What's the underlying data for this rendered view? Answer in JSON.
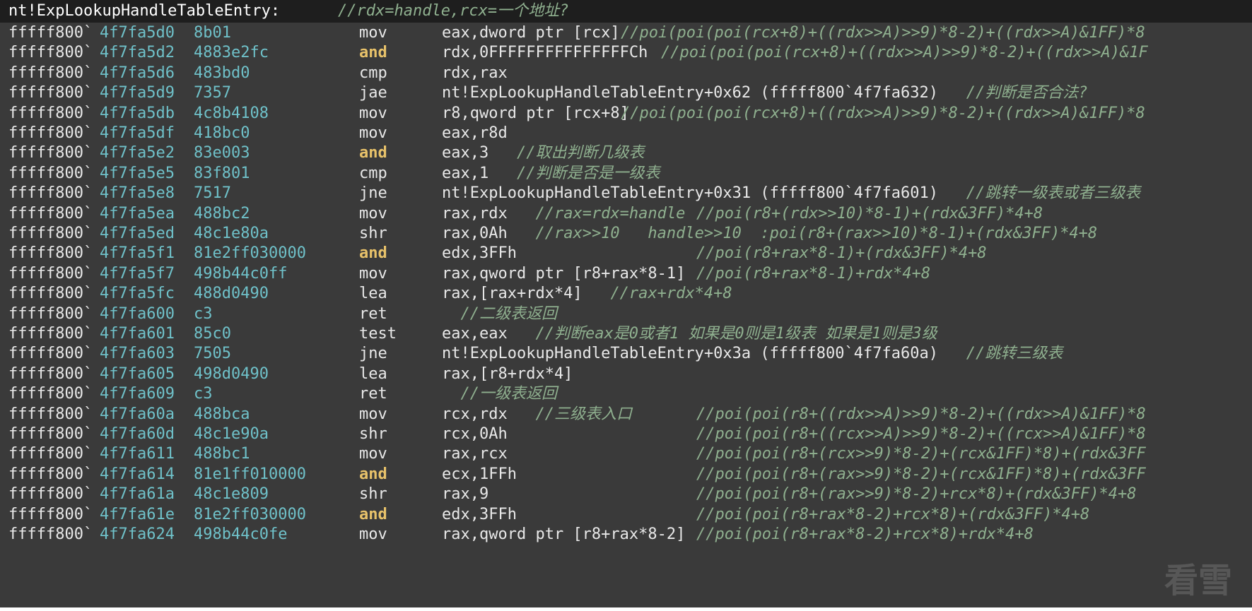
{
  "header": {
    "symbol": "nt!ExpLookupHandleTableEntry:",
    "comment": "//rdx=handle,rcx=一个地址?"
  },
  "rows": [
    {
      "ad1": "fffff800`",
      "ad2": "4f7fa5d0",
      "bytes": "8b01",
      "mnem": "mov",
      "hl": false,
      "ops": "eax,dword ptr [rcx]",
      "c1": "",
      "c2": "//poi(poi(poi(rcx+8)+((rdx>>A)>>9)*8-2)+((rdx>>A)&1FF)*8"
    },
    {
      "ad1": "fffff800`",
      "ad2": "4f7fa5d2",
      "bytes": "4883e2fc",
      "mnem": "and",
      "hl": true,
      "ops": "rdx,0FFFFFFFFFFFFFFFCh",
      "c1": "",
      "c2": "//poi(poi(poi(rcx+8)+((rdx>>A)>>9)*8-2)+((rdx>>A)&1F"
    },
    {
      "ad1": "fffff800`",
      "ad2": "4f7fa5d6",
      "bytes": "483bd0",
      "mnem": "cmp",
      "hl": false,
      "ops": "rdx,rax",
      "c1": "",
      "c2": ""
    },
    {
      "ad1": "fffff800`",
      "ad2": "4f7fa5d9",
      "bytes": "7357",
      "mnem": "jae",
      "hl": false,
      "ops": "nt!ExpLookupHandleTableEntry+0x62 (fffff800`4f7fa632)",
      "c1": "//判断是否合法?",
      "c2": ""
    },
    {
      "ad1": "fffff800`",
      "ad2": "4f7fa5db",
      "bytes": "4c8b4108",
      "mnem": "mov",
      "hl": false,
      "ops": "r8,qword ptr [rcx+8]",
      "c1": "",
      "c2": "//poi(poi(poi(rcx+8)+((rdx>>A)>>9)*8-2)+((rdx>>A)&1FF)*8"
    },
    {
      "ad1": "fffff800`",
      "ad2": "4f7fa5df",
      "bytes": "418bc0",
      "mnem": "mov",
      "hl": false,
      "ops": "eax,r8d",
      "c1": "",
      "c2": ""
    },
    {
      "ad1": "fffff800`",
      "ad2": "4f7fa5e2",
      "bytes": "83e003",
      "mnem": "and",
      "hl": true,
      "ops": "eax,3",
      "c1": "//取出判断几级表",
      "c2": ""
    },
    {
      "ad1": "fffff800`",
      "ad2": "4f7fa5e5",
      "bytes": "83f801",
      "mnem": "cmp",
      "hl": false,
      "ops": "eax,1",
      "c1": "//判断是否是一级表",
      "c2": ""
    },
    {
      "ad1": "fffff800`",
      "ad2": "4f7fa5e8",
      "bytes": "7517",
      "mnem": "jne",
      "hl": false,
      "ops": "nt!ExpLookupHandleTableEntry+0x31 (fffff800`4f7fa601)",
      "c1": "//跳转一级表或者三级表",
      "c2": ""
    },
    {
      "ad1": "fffff800`",
      "ad2": "4f7fa5ea",
      "bytes": "488bc2",
      "mnem": "mov",
      "hl": false,
      "ops": "rax,rdx",
      "c1": "//rax=rdx=handle",
      "c2": "//poi(r8+(rdx>>10)*8-1)+(rdx&3FF)*4+8"
    },
    {
      "ad1": "fffff800`",
      "ad2": "4f7fa5ed",
      "bytes": "48c1e80a",
      "mnem": "shr",
      "hl": false,
      "ops": "rax,0Ah",
      "c1": "//rax>>10   handle>>10  :poi(r8+(rax>>10)*8-1)+(rdx&3FF)*4+8",
      "c2": ""
    },
    {
      "ad1": "fffff800`",
      "ad2": "4f7fa5f1",
      "bytes": "81e2ff030000",
      "mnem": "and",
      "hl": true,
      "ops": "edx,3FFh",
      "c1": "",
      "c2": "//poi(r8+rax*8-1)+(rdx&3FF)*4+8"
    },
    {
      "ad1": "fffff800`",
      "ad2": "4f7fa5f7",
      "bytes": "498b44c0ff",
      "mnem": "mov",
      "hl": false,
      "ops": "rax,qword ptr [r8+rax*8-1]",
      "c1": "",
      "c2": "//poi(r8+rax*8-1)+rdx*4+8"
    },
    {
      "ad1": "fffff800`",
      "ad2": "4f7fa5fc",
      "bytes": "488d0490",
      "mnem": "lea",
      "hl": false,
      "ops": "rax,[rax+rdx*4]",
      "c1": "//rax+rdx*4+8",
      "c2": ""
    },
    {
      "ad1": "fffff800`",
      "ad2": "4f7fa600",
      "bytes": "c3",
      "mnem": "ret",
      "hl": false,
      "ops": "",
      "c1": "  //二级表返回",
      "c2": ""
    },
    {
      "ad1": "fffff800`",
      "ad2": "4f7fa601",
      "bytes": "85c0",
      "mnem": "test",
      "hl": false,
      "ops": "eax,eax",
      "c1": "//判断eax是0或者1 如果是0则是1级表 如果是1则是3级",
      "c2": ""
    },
    {
      "ad1": "fffff800`",
      "ad2": "4f7fa603",
      "bytes": "7505",
      "mnem": "jne",
      "hl": false,
      "ops": "nt!ExpLookupHandleTableEntry+0x3a (fffff800`4f7fa60a)",
      "c1": "//跳转三级表",
      "c2": ""
    },
    {
      "ad1": "fffff800`",
      "ad2": "4f7fa605",
      "bytes": "498d0490",
      "mnem": "lea",
      "hl": false,
      "ops": "rax,[r8+rdx*4]",
      "c1": "",
      "c2": ""
    },
    {
      "ad1": "fffff800`",
      "ad2": "4f7fa609",
      "bytes": "c3",
      "mnem": "ret",
      "hl": false,
      "ops": "",
      "c1": "  //一级表返回",
      "c2": ""
    },
    {
      "ad1": "fffff800`",
      "ad2": "4f7fa60a",
      "bytes": "488bca",
      "mnem": "mov",
      "hl": false,
      "ops": "rcx,rdx",
      "c1": "//三级表入口",
      "c2": "//poi(poi(r8+((rdx>>A)>>9)*8-2)+((rdx>>A)&1FF)*8"
    },
    {
      "ad1": "fffff800`",
      "ad2": "4f7fa60d",
      "bytes": "48c1e90a",
      "mnem": "shr",
      "hl": false,
      "ops": "rcx,0Ah",
      "c1": "",
      "c2": "//poi(poi(r8+((rcx>>A)>>9)*8-2)+((rcx>>A)&1FF)*8"
    },
    {
      "ad1": "fffff800`",
      "ad2": "4f7fa611",
      "bytes": "488bc1",
      "mnem": "mov",
      "hl": false,
      "ops": "rax,rcx",
      "c1": "",
      "c2": "//poi(poi(r8+(rcx>>9)*8-2)+(rcx&1FF)*8)+(rdx&3FF"
    },
    {
      "ad1": "fffff800`",
      "ad2": "4f7fa614",
      "bytes": "81e1ff010000",
      "mnem": "and",
      "hl": true,
      "ops": "ecx,1FFh",
      "c1": "",
      "c2": "//poi(poi(r8+(rax>>9)*8-2)+(rcx&1FF)*8)+(rdx&3FF"
    },
    {
      "ad1": "fffff800`",
      "ad2": "4f7fa61a",
      "bytes": "48c1e809",
      "mnem": "shr",
      "hl": false,
      "ops": "rax,9",
      "c1": "",
      "c2": "//poi(poi(r8+(rax>>9)*8-2)+rcx*8)+(rdx&3FF)*4+8"
    },
    {
      "ad1": "fffff800`",
      "ad2": "4f7fa61e",
      "bytes": "81e2ff030000",
      "mnem": "and",
      "hl": true,
      "ops": "edx,3FFh",
      "c1": "",
      "c2": "//poi(poi(r8+rax*8-2)+rcx*8)+(rdx&3FF)*4+8"
    },
    {
      "ad1": "fffff800`",
      "ad2": "4f7fa624",
      "bytes": "498b44c0fe",
      "mnem": "mov",
      "hl": false,
      "ops": "rax,qword ptr [r8+rax*8-2]",
      "c1": "",
      "c2": "//poi(poi(r8+rax*8-2)+rcx*8)+rdx*4+8"
    }
  ],
  "watermark": "看雪"
}
